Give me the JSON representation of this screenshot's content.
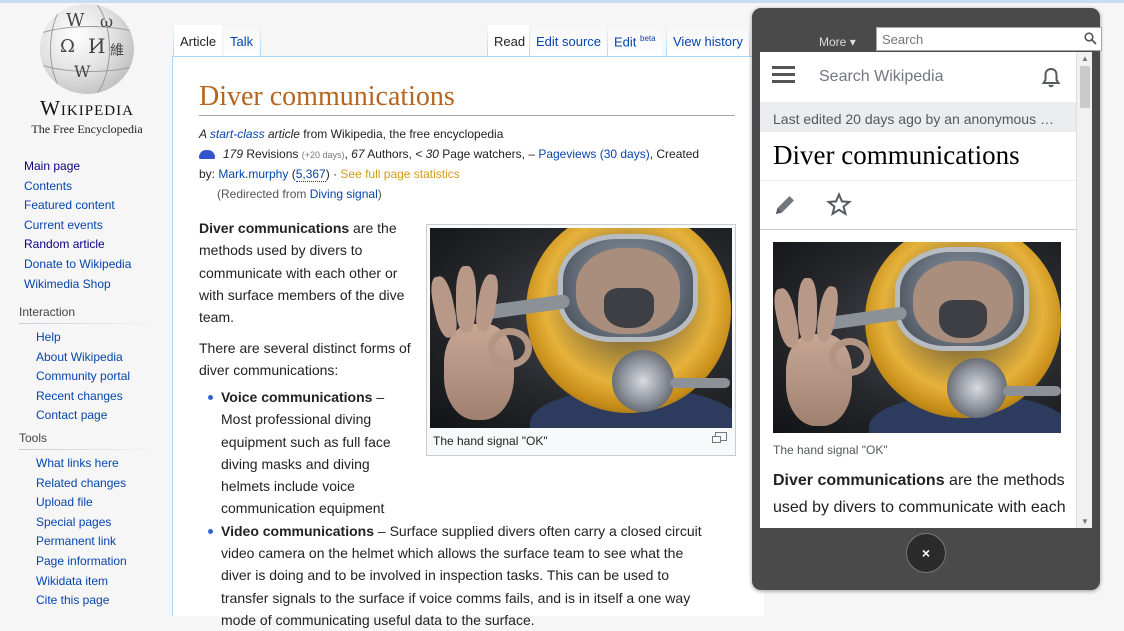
{
  "logo": {
    "wordmark": "Wikipedia",
    "tagline": "The Free Encyclopedia"
  },
  "sidebar": {
    "nav": [
      {
        "label": "Main page",
        "dark": true
      },
      {
        "label": "Contents",
        "dark": false
      },
      {
        "label": "Featured content",
        "dark": false
      },
      {
        "label": "Current events",
        "dark": false
      },
      {
        "label": "Random article",
        "dark": true
      },
      {
        "label": "Donate to Wikipedia",
        "dark": false
      },
      {
        "label": "Wikimedia Shop",
        "dark": false
      }
    ],
    "interaction": {
      "title": "Interaction",
      "items": [
        "Help",
        "About Wikipedia",
        "Community portal",
        "Recent changes",
        "Contact page"
      ]
    },
    "tools": {
      "title": "Tools",
      "items": [
        "What links here",
        "Related changes",
        "Upload file",
        "Special pages",
        "Permanent link",
        "Page information",
        "Wikidata item",
        "Cite this page"
      ]
    }
  },
  "tabs": {
    "article": "Article",
    "talk": "Talk",
    "read": "Read",
    "edit_source": "Edit source",
    "edit": "Edit",
    "edit_sup": "beta",
    "view_history": "View history",
    "more": "More"
  },
  "search": {
    "placeholder": "Search"
  },
  "article": {
    "title": "Diver communications",
    "meta1_pre": "A ",
    "meta1_class": "start-class",
    "meta1_article": "article",
    "meta1_post": " from Wikipedia, the free encyclopedia",
    "revisions": "179",
    "revisions_label": " Revisions ",
    "revisions_delta": "(+20 days)",
    "authors": "67",
    "authors_label": " Authors, ",
    "watchers": "< 30",
    "watchers_label": " Page watchers, – ",
    "pageviews": "Pageviews (30 days)",
    "created": ", Created",
    "by": "by: ",
    "creator": "Mark.murphy",
    "creator_edits": "5,367",
    "full_stats": "See full page statistics",
    "redirect_pre": "(Redirected from ",
    "redirect_link": "Diving signal",
    "redirect_post": ")",
    "p1_bold": "Diver communications",
    "p1_a": " are the methods used by ",
    "p1_link": "divers",
    "p1_b": " to communicate with each other or with surface members of the dive team.",
    "p2": "There are several distinct forms of diver communications:",
    "b1_bold": "Voice communications",
    "b1_a": " – Most professional ",
    "b1_link1": "diving equipment",
    "b1_b": " such as ",
    "b1_link2": "full face diving masks",
    "b1_c": " and ",
    "b1_link3": "diving helmets",
    "b1_d": " include ",
    "b1_link4": "voice communication",
    "b1_e": " equipment",
    "b2_bold": "Video communications",
    "b2_a": " – Surface supplied divers often carry a closed circuit video camera on the helmet which allows the surface team to see what the diver is doing and to be involved in inspection tasks. This can be used to transfer signals to the surface if voice comms fails, and is in itself a one way mode of communicating useful data to the surface.",
    "caption": "The hand signal \"OK\""
  },
  "mobile": {
    "search_placeholder": "Search Wikipedia",
    "last_edited": "Last edited 20 days ago by an anonymous …",
    "title": "Diver communications",
    "caption": "The hand signal \"OK\"",
    "p_bold": "Diver communications",
    "p_a": " are the methods used by ",
    "p_link": "divers",
    "p_b": " to communicate with each",
    "close": "×"
  }
}
